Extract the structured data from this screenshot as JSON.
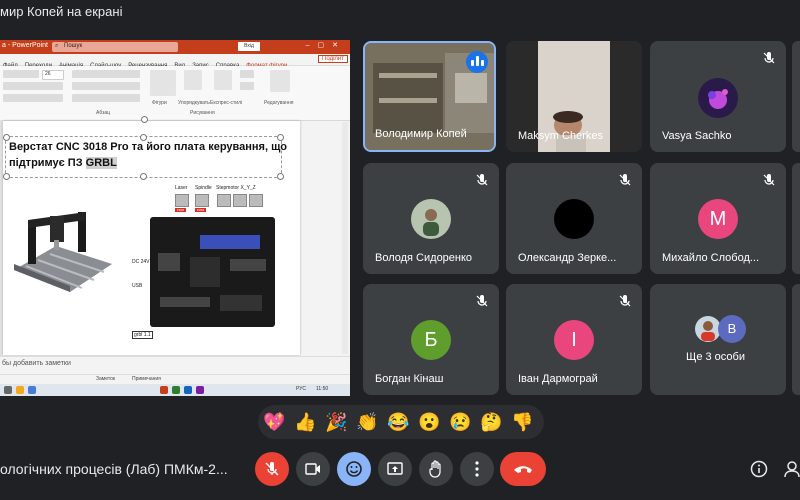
{
  "window": {
    "title": "мир Копей на екрані"
  },
  "presentation": {
    "app_title": "а - PowerPoint",
    "search_placeholder": "Пошук",
    "user_button": "Вхід",
    "tabs": [
      "Файл",
      "Переходи",
      "Анімація",
      "Слайд-шоу",
      "Рецензування",
      "Вид",
      "Запис",
      "Справка",
      "Формат фігури"
    ],
    "share": "Поділит",
    "ribbon": {
      "font_size": "26",
      "group_paragraph": "Абзац",
      "group_drawing": "Рисування",
      "shapes": "Фігури",
      "arrange": "Упорядкувать",
      "quick_styles": "Експрес-стилі",
      "editing": "Редагування"
    },
    "slide": {
      "title_line1": "Верстат CNC 3018 Pro та його плата керування, що",
      "title_line2_prefix": "підтримує ПЗ ",
      "title_line2_highlight": "GRBL",
      "labels": {
        "laser": "Laser",
        "spindle": "Spindle",
        "steppers": "Stepmotor X_Y_Z",
        "pwm1": "PWM",
        "pwm2": "PWM",
        "dc": "DC 24V",
        "usb": "USB",
        "grbl": "grbl 1.1"
      }
    },
    "notes_placeholder": "бы добавить заметки",
    "status": {
      "notes": "Заметок",
      "comments": "Примечания",
      "lang": "РУС",
      "time": "11:50"
    }
  },
  "participants": [
    {
      "name": "Володимир Копей",
      "speaking": true
    },
    {
      "name": "Maksym Cherkes",
      "muted": false
    },
    {
      "name": "Vasya Sachko",
      "muted": true
    },
    {
      "name": "Володя Сидоренко",
      "muted": true
    },
    {
      "name": "Олександр Зерке...",
      "muted": true
    },
    {
      "name": "Михайло Слобод...",
      "muted": true,
      "initial": "М",
      "color": "#e8467c"
    },
    {
      "name": "Богдан Кінаш",
      "muted": true,
      "initial": "Б",
      "color": "#5f9e2d"
    },
    {
      "name": "Іван Дармограй",
      "muted": true,
      "initial": "І",
      "color": "#e8467c"
    },
    {
      "name": "Ще 3 особи",
      "initial": "В",
      "color": "#5c6bc0"
    }
  ],
  "reactions": [
    "💖",
    "👍",
    "🎉",
    "👏",
    "😂",
    "😮",
    "😢",
    "🤔",
    "👎"
  ],
  "meeting": {
    "name": "ологічних процесів (Лаб) ПМКм-2..."
  },
  "controls": [
    "mic-off",
    "camera",
    "reactions",
    "present",
    "raise-hand",
    "more",
    "end-call",
    "info",
    "people"
  ]
}
